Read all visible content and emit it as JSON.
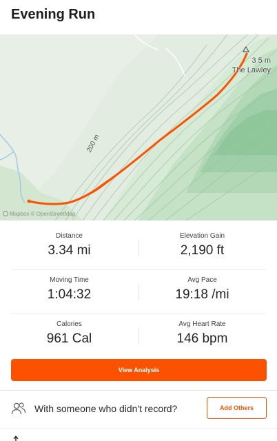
{
  "activity": {
    "title": "Evening Run"
  },
  "map": {
    "peak_elevation_label": "3 5 m",
    "peak_name_label": "The Lawley",
    "contour_label": "200 m",
    "attribution": "Mapbox © OpenStreetMap",
    "route_color": "#fc5200",
    "terrain_color": "#9fcfa8"
  },
  "stats": {
    "distance": {
      "label": "Distance",
      "value": "3.34 mi"
    },
    "elevation_gain": {
      "label": "Elevation Gain",
      "value": "2,190 ft"
    },
    "moving_time": {
      "label": "Moving Time",
      "value": "1:04:32"
    },
    "avg_pace": {
      "label": "Avg Pace",
      "value": "19:18 /mi"
    },
    "calories": {
      "label": "Calories",
      "value": "961 Cal"
    },
    "avg_heart_rate": {
      "label": "Avg Heart Rate",
      "value": "146 bpm"
    }
  },
  "actions": {
    "view_analysis_label": "View Analysis",
    "others_prompt": "With someone who didn't record?",
    "add_others_label": "Add Others",
    "people_icon": "people-icon",
    "accent_color": "#fc5200"
  }
}
